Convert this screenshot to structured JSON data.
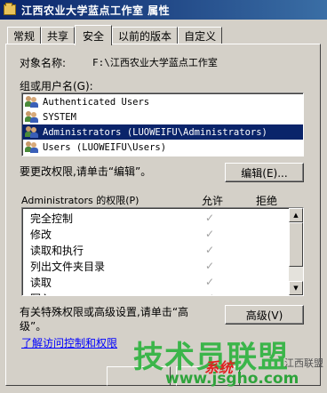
{
  "window": {
    "title": "江西农业大学蓝点工作室 属性"
  },
  "tabs": [
    {
      "label": "常规"
    },
    {
      "label": "共享"
    },
    {
      "label": "安全",
      "active": true
    },
    {
      "label": "以前的版本"
    },
    {
      "label": "自定义"
    }
  ],
  "object": {
    "label": "对象名称:",
    "value": "F:\\江西农业大学蓝点工作室"
  },
  "groups": {
    "label": "组或用户名(G):",
    "users": [
      {
        "name": "Authenticated Users"
      },
      {
        "name": "SYSTEM"
      },
      {
        "name": "Administrators (LUOWEIFU\\Administrators)",
        "selected": true
      },
      {
        "name": "Users (LUOWEIFU\\Users)"
      }
    ]
  },
  "change_hint": "要更改权限,请单击“编辑”。",
  "edit_button": "编辑(E)...",
  "permissions": {
    "label": "Administrators 的权限(P)",
    "allow_header": "允许",
    "deny_header": "拒绝",
    "items": [
      {
        "name": "完全控制",
        "allow": true
      },
      {
        "name": "修改",
        "allow": true
      },
      {
        "name": "读取和执行",
        "allow": true
      },
      {
        "name": "列出文件夹目录",
        "allow": true
      },
      {
        "name": "读取",
        "allow": true
      },
      {
        "name": "写入",
        "allow": true
      }
    ]
  },
  "advanced": {
    "hint": "有关特殊权限或高级设置,请单击“高级”。",
    "button": "高级(V)"
  },
  "help_link": "了解访问控制和权限",
  "watermark": {
    "main": "技术员联盟",
    "url": "www.jsgho.com",
    "red": "系统",
    "small": "江西联盟"
  },
  "colors": {
    "selection": "#0a246a",
    "titlebar": "#0a246a",
    "watermark_green": "#3bb54a"
  }
}
